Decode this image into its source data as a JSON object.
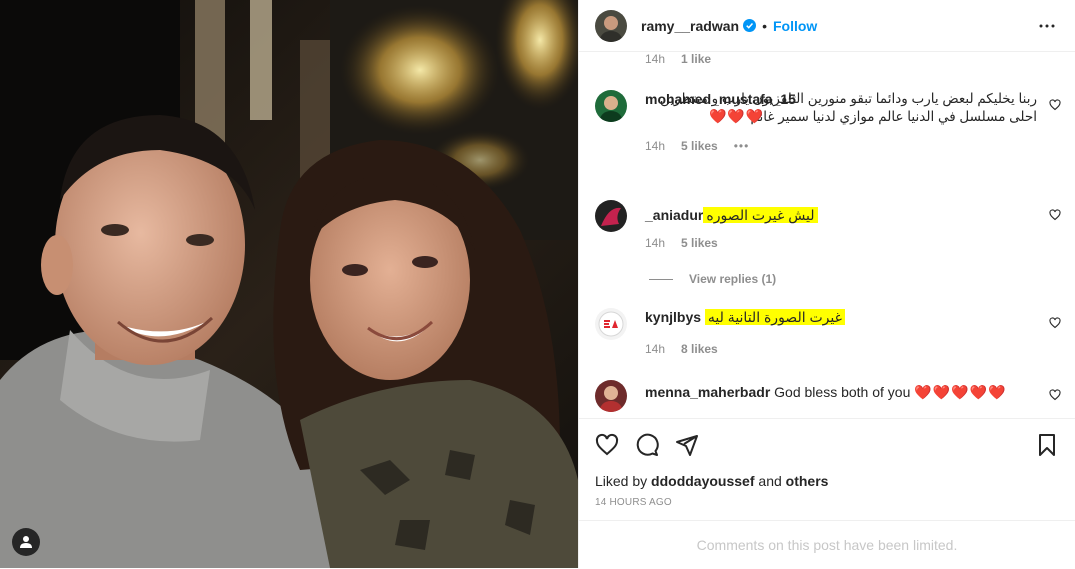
{
  "post": {
    "username": "ramy__radwan",
    "dot": "•",
    "follow_label": "Follow",
    "liked_by_prefix": "Liked by",
    "liked_by_user": "ddoddayoussef",
    "liked_by_and": "and",
    "liked_by_others": "others",
    "timestamp": "14 HOURS AGO",
    "comments_limited": "Comments on this post have been limited."
  },
  "comments": [
    {
      "time": "14h",
      "likes": "1 like"
    },
    {
      "username": "mohamed_mustafa_15",
      "text": "ربنا يخليكم لبعض يارب ودائما تبقو منورين التلفزيون يارب و منتظرين احلى مسلسل في الدنيا عالم موازي لدنيا سمير غانم",
      "hearts": "❤️❤️❤️",
      "time": "14h",
      "likes": "5 likes",
      "options": "•••"
    },
    {
      "username": "_aniadur",
      "text": "ليش غيرت الصوره",
      "time": "14h",
      "likes": "5 likes",
      "view_replies": "View replies (1)"
    },
    {
      "username": "kynjlbys",
      "text": "غيرت الصورة التانية ليه",
      "time": "14h",
      "likes": "8 likes"
    },
    {
      "username": "menna_maherbadr",
      "text": "God bless both of you",
      "hearts": "❤️❤️❤️❤️❤️"
    }
  ],
  "icons": {
    "verified": "verified-badge-icon",
    "more": "more-options-icon",
    "like": "heart-icon",
    "comment": "comment-icon",
    "share": "share-icon",
    "save": "bookmark-icon",
    "tags": "user-tag-icon"
  },
  "colors": {
    "accent": "#0095f6",
    "highlight": "#ffff00",
    "heart": "#ed4956",
    "muted": "#8e8e8e"
  }
}
